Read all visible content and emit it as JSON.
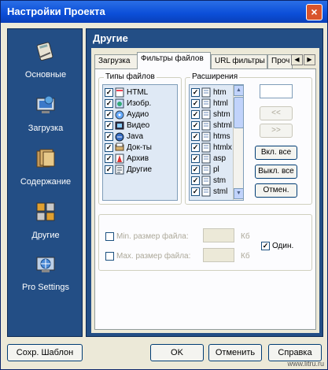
{
  "window": {
    "title": "Настройки Проекта",
    "close_glyph": "×"
  },
  "sidebar": {
    "items": [
      {
        "label": "Основные",
        "icon": "settings-book-icon"
      },
      {
        "label": "Загрузка",
        "icon": "download-monitor-icon"
      },
      {
        "label": "Содержание",
        "icon": "folders-icon"
      },
      {
        "label": "Другие",
        "icon": "other-grid-icon"
      },
      {
        "label": "Pro Settings",
        "icon": "globe-monitor-icon"
      }
    ]
  },
  "main": {
    "title": "Другие",
    "tabs": [
      {
        "label": "Загрузка",
        "active": false
      },
      {
        "label": "Фильтры файлов",
        "active": true
      },
      {
        "label": "URL фильтры",
        "active": false
      },
      {
        "label": "Проч",
        "active": false
      }
    ],
    "tab_scroll": {
      "left": "◀",
      "right": "▶"
    }
  },
  "file_types": {
    "legend": "Типы файлов",
    "items": [
      {
        "label": "HTML",
        "checked": true,
        "icon": "html-file-icon"
      },
      {
        "label": "Изобр.",
        "checked": true,
        "icon": "image-file-icon"
      },
      {
        "label": "Аудио",
        "checked": true,
        "icon": "audio-file-icon"
      },
      {
        "label": "Видео",
        "checked": true,
        "icon": "video-file-icon"
      },
      {
        "label": "Java",
        "checked": true,
        "icon": "java-file-icon"
      },
      {
        "label": "Док-ты",
        "checked": true,
        "icon": "document-file-icon"
      },
      {
        "label": "Архив",
        "checked": true,
        "icon": "archive-file-icon"
      },
      {
        "label": "Другие",
        "checked": true,
        "icon": "other-file-icon"
      }
    ]
  },
  "extensions": {
    "legend": "Расширения",
    "items": [
      "htm",
      "html",
      "shtm",
      "shtml",
      "htms",
      "htmlx",
      "asp",
      "pl",
      "stm",
      "stml"
    ],
    "checked": true,
    "buttons": {
      "move_left": "<<",
      "move_right": ">>",
      "enable_all": "Вкл. все",
      "disable_all": "Выкл. все",
      "cancel": "Отмен."
    }
  },
  "size_filter": {
    "min_label": "Min. размер файла:",
    "max_label": "Max. размер файла:",
    "unit": "Кб",
    "single_label": "Один.",
    "single_checked": true
  },
  "footer": {
    "save_template": "Сохр. Шаблон",
    "ok": "OK",
    "cancel": "Отменить",
    "help": "Справка"
  },
  "watermark": "www.litru.ru"
}
